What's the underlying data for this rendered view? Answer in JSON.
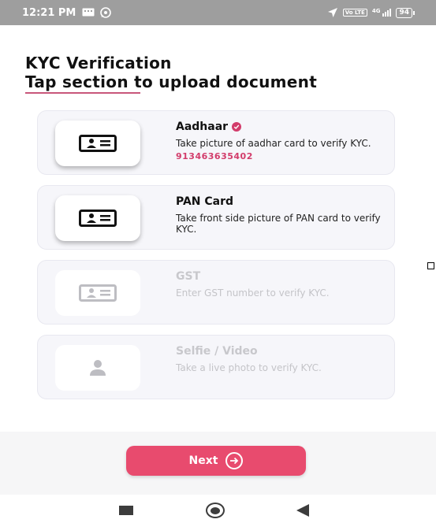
{
  "status_bar": {
    "time": "12:21 PM",
    "left_icons": [
      "message-icon",
      "whatsapp-icon"
    ],
    "right_icons": [
      "location-arrow-icon",
      "volte-icon",
      "signal-icon",
      "battery-icon"
    ],
    "network": "4G",
    "volte": "Vo LTE",
    "battery": "94"
  },
  "header": {
    "title": "KYC Verification",
    "subtitle": "Tap section to upload document",
    "accent_color": "#c8577a"
  },
  "cards": [
    {
      "name": "Aadhaar",
      "description": "Take picture of aadhar card to verify KYC.",
      "number": "913463635402",
      "verified": true,
      "enabled": true,
      "icon": "id-card-icon"
    },
    {
      "name": "PAN Card",
      "description": "Take front side picture of PAN card to verify KYC.",
      "enabled": true,
      "icon": "id-card-icon"
    },
    {
      "name": "GST",
      "description": "Enter GST number to verify KYC.",
      "enabled": false,
      "icon": "id-card-icon"
    },
    {
      "name": "Selfie / Video",
      "description": "Take a live photo to verify KYC.",
      "enabled": false,
      "icon": "person-icon"
    }
  ],
  "footer": {
    "next_label": "Next",
    "button_color": "#e84b6e",
    "icon": "arrow-right-circle-icon"
  },
  "nav_bar": {
    "icons": [
      "recents-icon",
      "home-icon",
      "back-icon"
    ]
  }
}
